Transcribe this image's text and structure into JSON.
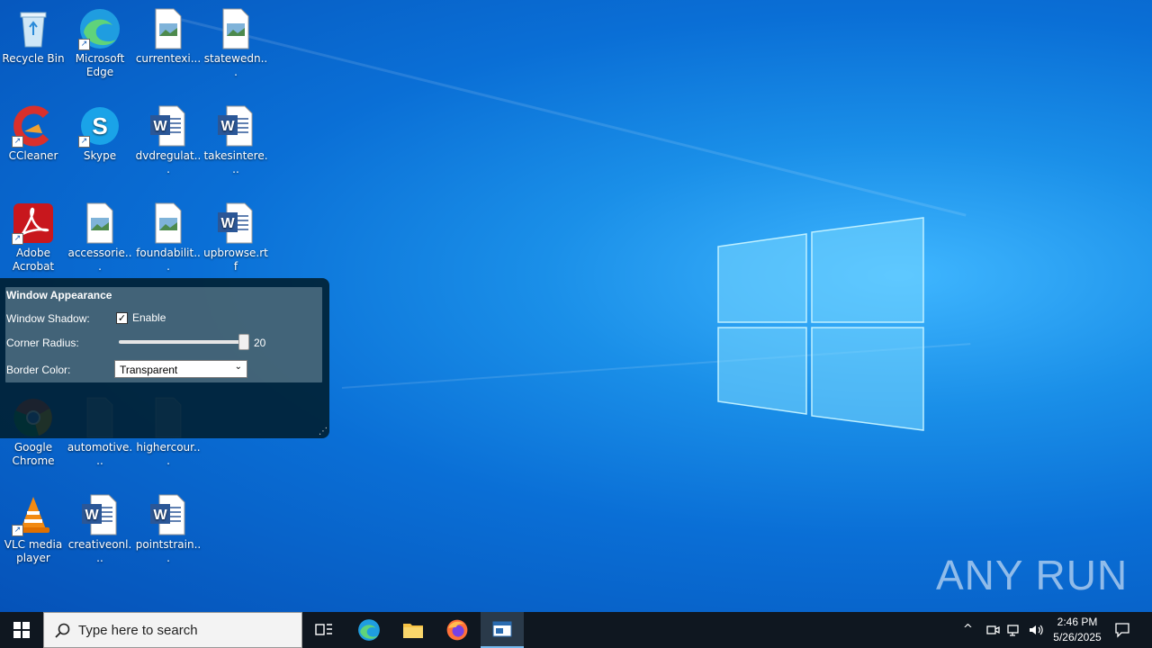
{
  "desktop": {
    "icons": [
      {
        "label": "Recycle Bin",
        "icon": "recycle-bin-icon"
      },
      {
        "label": "Microsoft Edge",
        "icon": "edge-icon"
      },
      {
        "label": "currentexi...",
        "icon": "image-file-icon"
      },
      {
        "label": "statewedn...",
        "icon": "image-file-icon"
      },
      {
        "label": "CCleaner",
        "icon": "ccleaner-icon"
      },
      {
        "label": "Skype",
        "icon": "skype-icon"
      },
      {
        "label": "dvdregulat...",
        "icon": "word-doc-icon"
      },
      {
        "label": "takesintere...",
        "icon": "word-doc-icon"
      },
      {
        "label": "Adobe Acrobat",
        "icon": "acrobat-icon"
      },
      {
        "label": "accessorie...",
        "icon": "image-file-icon"
      },
      {
        "label": "foundabilit...",
        "icon": "image-file-icon"
      },
      {
        "label": "upbrowse.rtf",
        "icon": "word-doc-icon"
      },
      {
        "label": "Google Chrome",
        "icon": "chrome-icon"
      },
      {
        "label": "automotive...",
        "icon": "file-icon"
      },
      {
        "label": "highercour...",
        "icon": "file-icon"
      },
      {
        "label": "VLC media player",
        "icon": "vlc-icon"
      },
      {
        "label": "creativeonl...",
        "icon": "word-doc-icon"
      },
      {
        "label": "pointstrain...",
        "icon": "word-doc-icon"
      }
    ]
  },
  "panel": {
    "title": "Window Appearance",
    "shadow_label": "Window Shadow:",
    "shadow_checkbox_label": "Enable",
    "shadow_enabled": true,
    "radius_label": "Corner Radius:",
    "radius_value": "20",
    "border_label": "Border Color:",
    "border_value": "Transparent"
  },
  "taskbar": {
    "search_placeholder": "Type here to search",
    "time": "2:46 PM",
    "date": "5/26/2025"
  },
  "watermark": "ANY RUN"
}
